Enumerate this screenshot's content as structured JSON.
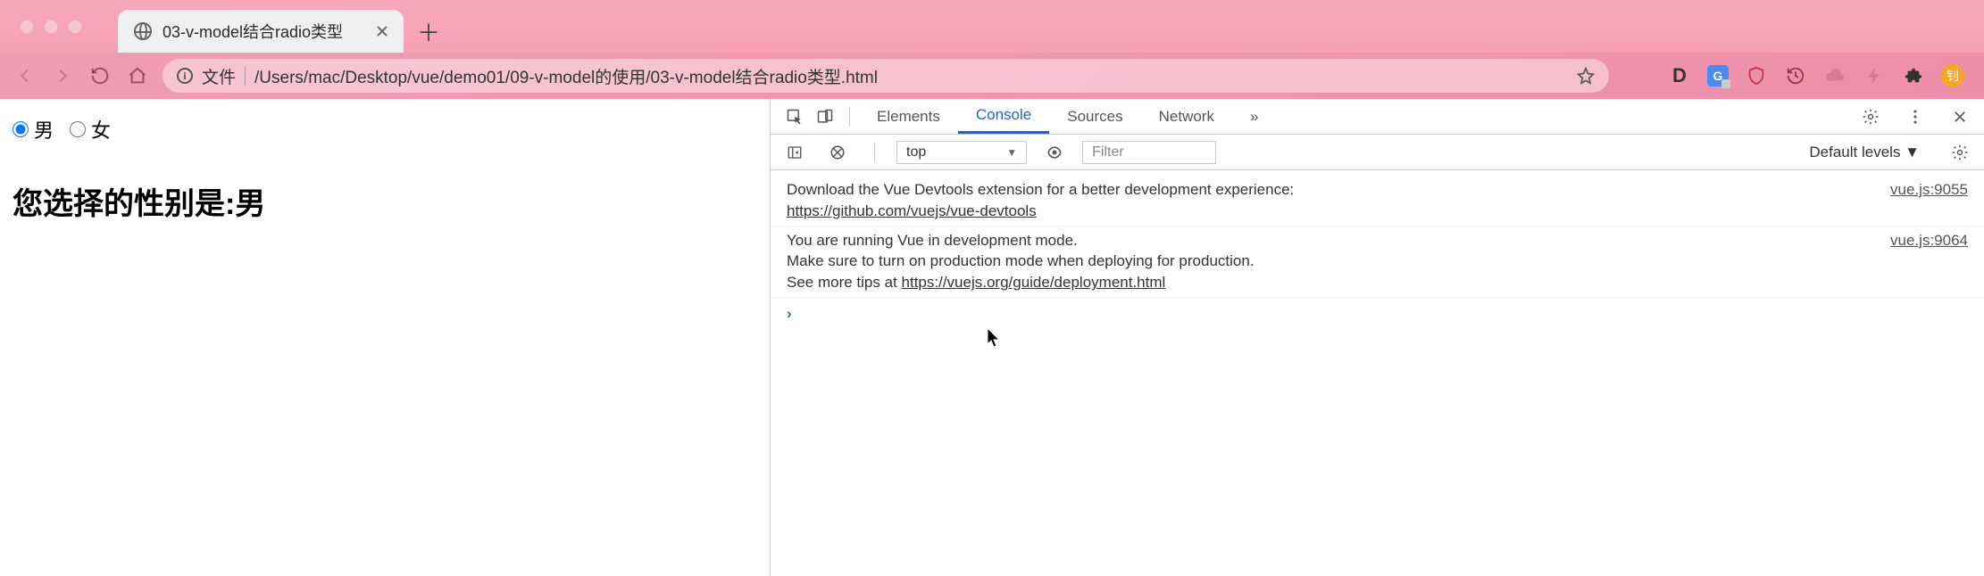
{
  "window": {
    "tab_title": "03-v-model结合radio类型",
    "url_label": "文件",
    "url_path": "/Users/mac/Desktop/vue/demo01/09-v-model的使用/03-v-model结合radio类型.html"
  },
  "page": {
    "radio_male": "男",
    "radio_female": "女",
    "result_heading": "您选择的性别是:男"
  },
  "devtools": {
    "tabs": {
      "elements": "Elements",
      "console": "Console",
      "sources": "Sources",
      "network": "Network",
      "more": "»"
    },
    "filter_row": {
      "context": "top",
      "filter_placeholder": "Filter",
      "levels": "Default levels ▼"
    },
    "logs": [
      {
        "msg_pre": "Download the Vue Devtools extension for a better development experience:\n",
        "link": "https://github.com/vuejs/vue-devtools",
        "src": "vue.js:9055"
      },
      {
        "msg_pre": "You are running Vue in development mode.\nMake sure to turn on production mode when deploying for production.\nSee more tips at ",
        "link": "https://vuejs.org/guide/deployment.html",
        "src": "vue.js:9064"
      }
    ],
    "prompt": "›"
  },
  "ext": {
    "avatar_initial": "钊"
  }
}
